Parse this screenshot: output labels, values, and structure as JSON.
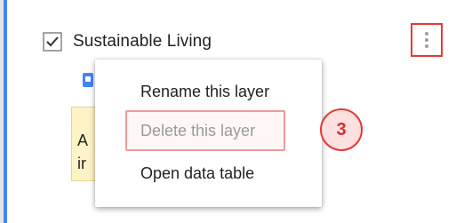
{
  "layer": {
    "checked": true,
    "title": "Sustainable Living"
  },
  "warning": {
    "line1": "A",
    "line2": "ir"
  },
  "menu": {
    "items": [
      {
        "label": "Rename this layer"
      },
      {
        "label": "Delete this layer"
      },
      {
        "label": "Open data table"
      }
    ]
  },
  "annotation": {
    "step": "3",
    "color": "#e53935"
  },
  "icons": {
    "checkbox": "checkbox-checked-icon",
    "more": "more-vert-icon",
    "style": "layer-style-icon"
  },
  "colors": {
    "accent": "#4285f4",
    "highlight_border": "#e53935",
    "warning_bg": "#fdf3c6"
  }
}
